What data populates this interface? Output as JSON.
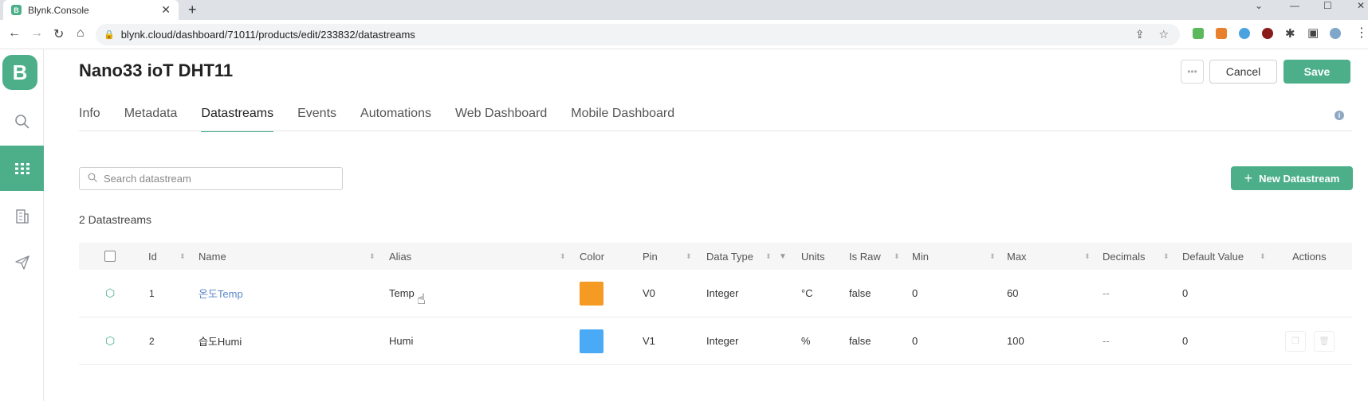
{
  "browser": {
    "tab_title": "Blynk.Console",
    "tab_favicon": "B",
    "tab_close": "✕",
    "new_tab": "+",
    "url": "blynk.cloud/dashboard/71011/products/edit/233832/datastreams"
  },
  "sidebar": {
    "logo": "B",
    "items": [
      {
        "icon": "search-icon"
      },
      {
        "icon": "grid-icon",
        "active": true
      },
      {
        "icon": "building-icon"
      },
      {
        "icon": "send-icon"
      }
    ]
  },
  "header": {
    "title": "Nano33 ioT DHT11",
    "more_label": "•••",
    "cancel_label": "Cancel",
    "save_label": "Save"
  },
  "tabs": [
    {
      "label": "Info"
    },
    {
      "label": "Metadata"
    },
    {
      "label": "Datastreams",
      "active": true
    },
    {
      "label": "Events"
    },
    {
      "label": "Automations"
    },
    {
      "label": "Web Dashboard"
    },
    {
      "label": "Mobile Dashboard"
    }
  ],
  "search": {
    "placeholder": "Search datastream"
  },
  "new_datastream_label": "New Datastream",
  "count_label": "2 Datastreams",
  "table": {
    "columns": [
      "Id",
      "Name",
      "Alias",
      "Color",
      "Pin",
      "Data Type",
      "Units",
      "Is Raw",
      "Min",
      "Max",
      "Decimals",
      "Default Value",
      "Actions"
    ],
    "rows": [
      {
        "id": "1",
        "name": "온도Temp",
        "alias": "Temp",
        "color": "#f59a23",
        "pin": "V0",
        "data_type": "Integer",
        "units": "°C",
        "is_raw": "false",
        "min": "0",
        "max": "60",
        "decimals": "--",
        "default": "0"
      },
      {
        "id": "2",
        "name": "습도Humi",
        "alias": "Humi",
        "color": "#4aaaf5",
        "pin": "V1",
        "data_type": "Integer",
        "units": "%",
        "is_raw": "false",
        "min": "0",
        "max": "100",
        "decimals": "--",
        "default": "0"
      }
    ]
  },
  "colors": {
    "accent": "#4caf8a",
    "link": "#5a87c8"
  }
}
